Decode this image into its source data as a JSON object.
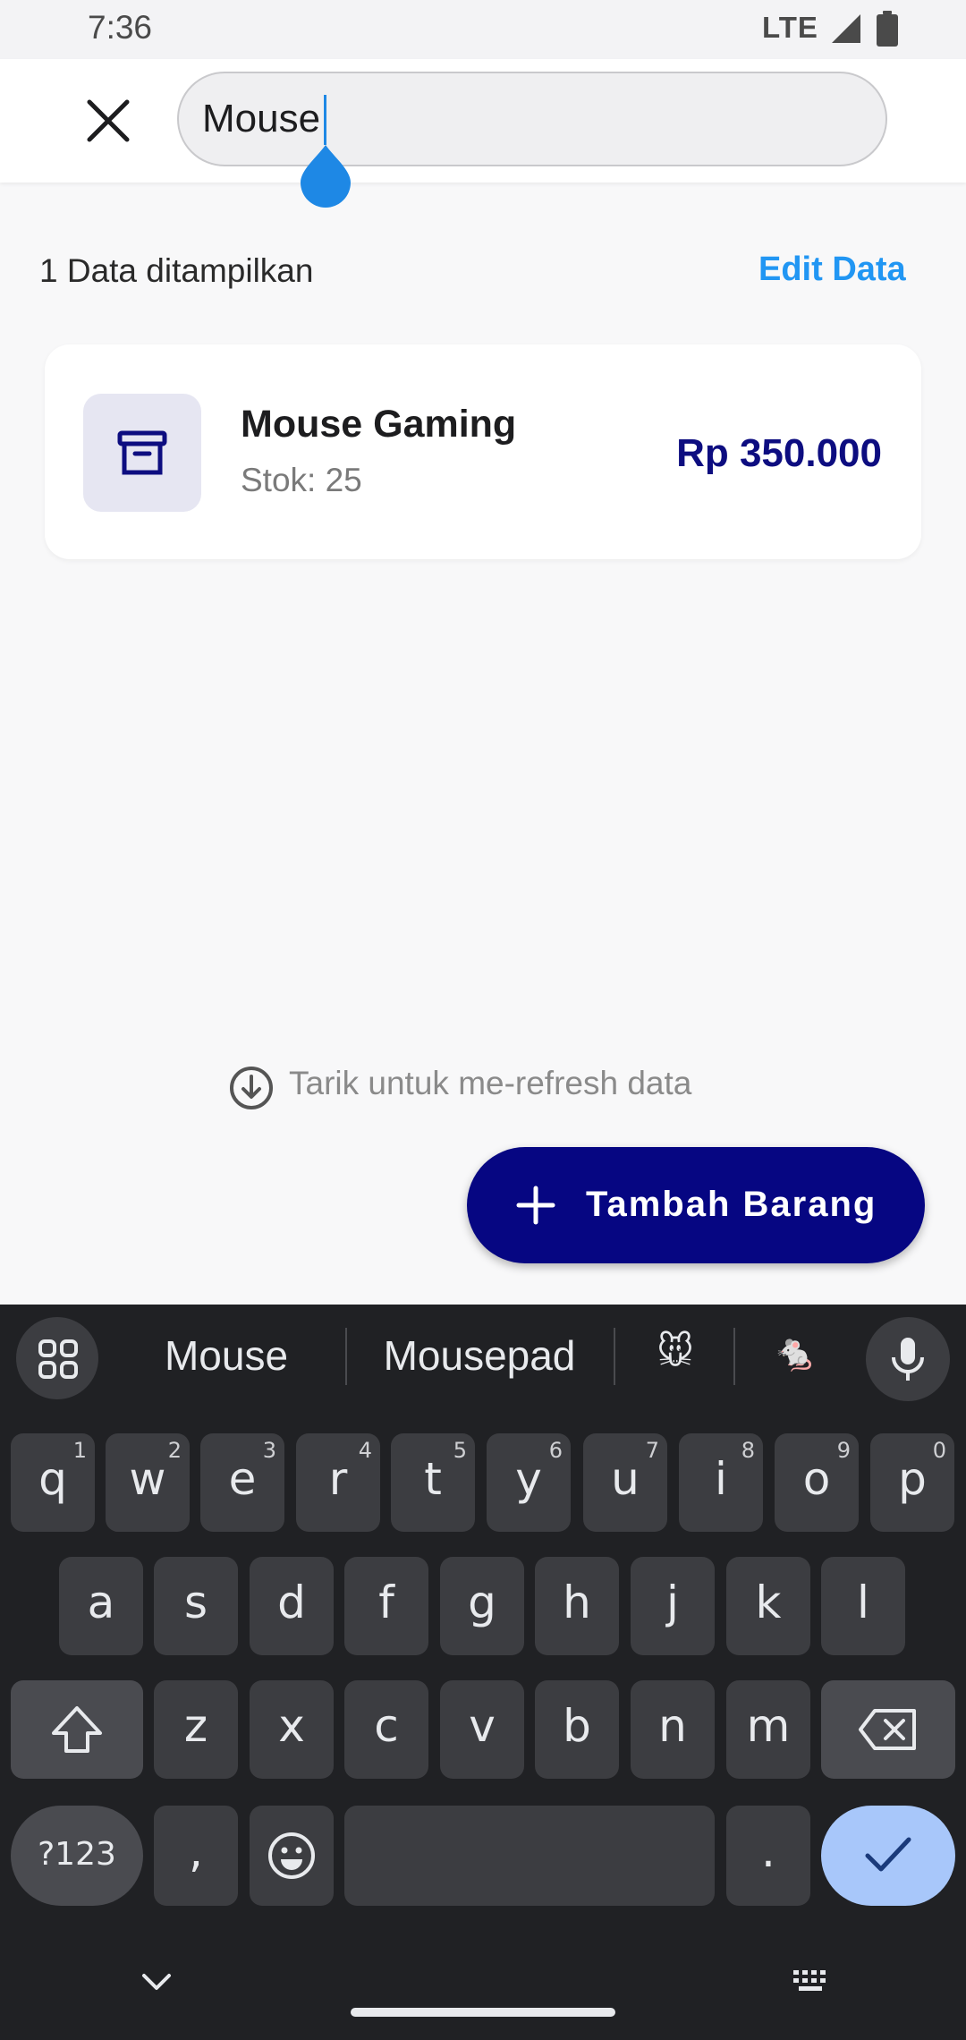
{
  "status_bar": {
    "time": "7:36",
    "network": "LTE"
  },
  "search": {
    "value": "Mouse"
  },
  "summary": {
    "count_text": "1 Data ditampilkan",
    "edit_label": "Edit Data"
  },
  "items": [
    {
      "name": "Mouse Gaming",
      "stock": "Stok: 25",
      "price": "Rp 350.000"
    }
  ],
  "refresh_hint": "Tarik untuk me-refresh data",
  "fab": {
    "label": "Tambah Barang"
  },
  "keyboard": {
    "suggestions": [
      "Mouse",
      "Mousepad",
      "🐭",
      "🐁"
    ],
    "row1": [
      {
        "k": "q",
        "h": "1"
      },
      {
        "k": "w",
        "h": "2"
      },
      {
        "k": "e",
        "h": "3"
      },
      {
        "k": "r",
        "h": "4"
      },
      {
        "k": "t",
        "h": "5"
      },
      {
        "k": "y",
        "h": "6"
      },
      {
        "k": "u",
        "h": "7"
      },
      {
        "k": "i",
        "h": "8"
      },
      {
        "k": "o",
        "h": "9"
      },
      {
        "k": "p",
        "h": "0"
      }
    ],
    "row2": [
      "a",
      "s",
      "d",
      "f",
      "g",
      "h",
      "j",
      "k",
      "l"
    ],
    "row3": [
      "z",
      "x",
      "c",
      "v",
      "b",
      "n",
      "m"
    ],
    "symbols_label": "?123",
    "comma": ",",
    "period": "."
  },
  "colors": {
    "accent": "#2196f3",
    "primary": "#060682",
    "price": "#0d0d80"
  }
}
